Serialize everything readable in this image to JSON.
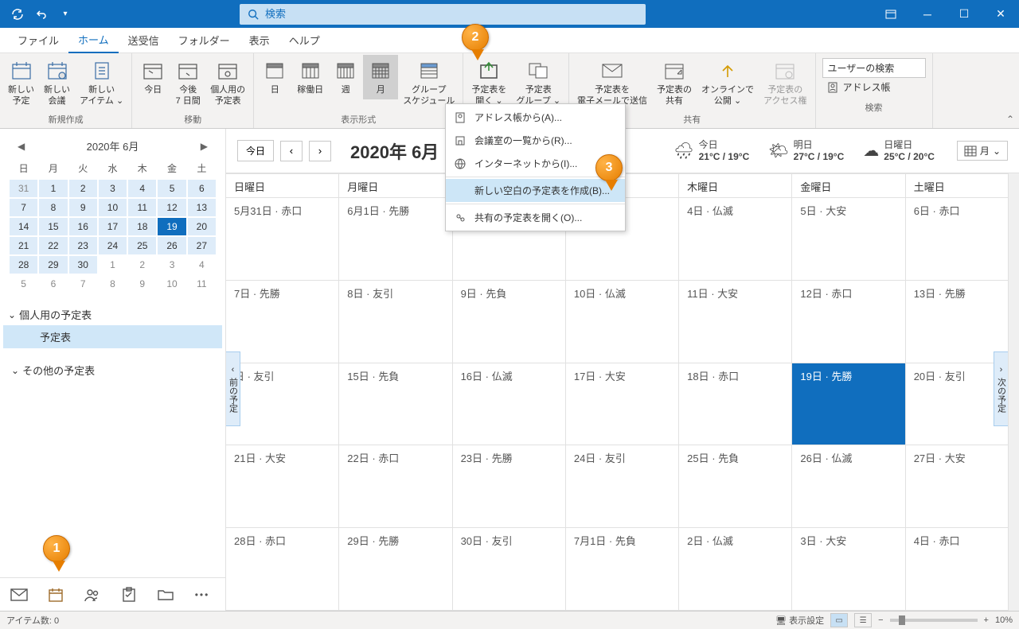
{
  "search_placeholder": "検索",
  "tabs": [
    "ファイル",
    "ホーム",
    "送受信",
    "フォルダー",
    "表示",
    "ヘルプ"
  ],
  "active_tab": 1,
  "ribbon": {
    "new": {
      "label": "新規作成",
      "appointment": "新しい\n予定",
      "meeting": "新しい\n会議",
      "items": "新しい\nアイテム ⌄"
    },
    "move": {
      "label": "移動",
      "today": "今日",
      "next7": "今後\n7 日間",
      "personal": "個人用の\n予定表"
    },
    "arrange": {
      "label": "表示形式",
      "day": "日",
      "workweek": "稼働日",
      "week": "週",
      "month": "月",
      "group": "グループ\nスケジュール"
    },
    "manage": {
      "open_cal": "予定表を\n開く ⌄",
      "cal_groups": "予定表\nグループ ⌄"
    },
    "share": {
      "label": "共有",
      "email": "予定表を\n電子メールで送信",
      "share": "予定表の\n共有",
      "publish": "オンラインで\n公開 ⌄",
      "perms": "予定表の\nアクセス権"
    },
    "find": {
      "label": "検索",
      "search_user": "ユーザーの検索",
      "address_book": "アドレス帳"
    }
  },
  "dropdown": {
    "address": "アドレス帳から(A)...",
    "rooms": "会議室の一覧から(R)...",
    "internet": "インターネットから(I)...",
    "blank": "新しい空白の予定表を作成(B)...",
    "shared": "共有の予定表を開く(O)..."
  },
  "mini_cal": {
    "title": "2020年 6月",
    "dow": [
      "日",
      "月",
      "火",
      "水",
      "木",
      "金",
      "土"
    ],
    "weeks": [
      [
        {
          "d": 31,
          "o": true,
          "c": true
        },
        {
          "d": 1,
          "c": true
        },
        {
          "d": 2,
          "c": true
        },
        {
          "d": 3,
          "c": true
        },
        {
          "d": 4,
          "c": true
        },
        {
          "d": 5,
          "c": true
        },
        {
          "d": 6,
          "c": true
        }
      ],
      [
        {
          "d": 7,
          "c": true
        },
        {
          "d": 8,
          "c": true
        },
        {
          "d": 9,
          "c": true
        },
        {
          "d": 10,
          "c": true
        },
        {
          "d": 11,
          "c": true
        },
        {
          "d": 12,
          "c": true
        },
        {
          "d": 13,
          "c": true
        }
      ],
      [
        {
          "d": 14,
          "c": true
        },
        {
          "d": 15,
          "c": true
        },
        {
          "d": 16,
          "c": true
        },
        {
          "d": 17,
          "c": true
        },
        {
          "d": 18,
          "c": true
        },
        {
          "d": 19,
          "c": true,
          "t": true
        },
        {
          "d": 20,
          "c": true
        }
      ],
      [
        {
          "d": 21,
          "c": true
        },
        {
          "d": 22,
          "c": true
        },
        {
          "d": 23,
          "c": true
        },
        {
          "d": 24,
          "c": true
        },
        {
          "d": 25,
          "c": true
        },
        {
          "d": 26,
          "c": true
        },
        {
          "d": 27,
          "c": true
        }
      ],
      [
        {
          "d": 28,
          "c": true
        },
        {
          "d": 29,
          "c": true
        },
        {
          "d": 30,
          "c": true
        },
        {
          "d": 1,
          "o": true
        },
        {
          "d": 2,
          "o": true
        },
        {
          "d": 3,
          "o": true
        },
        {
          "d": 4,
          "o": true
        }
      ],
      [
        {
          "d": 5,
          "o": true
        },
        {
          "d": 6,
          "o": true
        },
        {
          "d": 7,
          "o": true
        },
        {
          "d": 8,
          "o": true
        },
        {
          "d": 9,
          "o": true
        },
        {
          "d": 10,
          "o": true
        },
        {
          "d": 11,
          "o": true
        }
      ]
    ]
  },
  "cal_list": {
    "personal_header": "個人用の予定表",
    "personal_item": "予定表",
    "other_header": "その他の予定表"
  },
  "cal_toolbar": {
    "today": "今日",
    "title": "2020年 6月",
    "view_label": "月"
  },
  "weather": [
    {
      "label": "今日",
      "temp": "21°C / 19°C",
      "icon": "🌧"
    },
    {
      "label": "明日",
      "temp": "27°C / 19°C",
      "icon": "🌤"
    },
    {
      "label": "日曜日",
      "temp": "25°C / 20°C",
      "icon": "☁"
    }
  ],
  "day_headers": [
    "日曜日",
    "月曜日",
    "",
    "",
    "木曜日",
    "金曜日",
    "土曜日"
  ],
  "side_handles": {
    "prev": "前の予定",
    "next": "次の予定"
  },
  "cells": [
    [
      "5月31日 · 赤口",
      "6月1日 · 先勝",
      "",
      "",
      "4日 · 仏滅",
      "5日 · 大安",
      "6日 · 赤口"
    ],
    [
      "7日 · 先勝",
      "8日 · 友引",
      "9日 · 先負",
      "10日 · 仏滅",
      "11日 · 大安",
      "12日 · 赤口",
      "13日 · 先勝"
    ],
    [
      "日 · 友引",
      "15日 · 先負",
      "16日 · 仏滅",
      "17日 · 大安",
      "18日 · 赤口",
      "19日 · 先勝",
      "20日 · 友引"
    ],
    [
      "21日 · 大安",
      "22日 · 赤口",
      "23日 · 先勝",
      "24日 · 友引",
      "25日 · 先負",
      "26日 · 仏滅",
      "27日 · 大安"
    ],
    [
      "28日 · 赤口",
      "29日 · 先勝",
      "30日 · 友引",
      "7月1日 · 先負",
      "2日 · 仏滅",
      "3日 · 大安",
      "4日 · 赤口"
    ]
  ],
  "today_cell": [
    2,
    5
  ],
  "status": {
    "items": "アイテム数: 0",
    "display": "表示設定",
    "zoom": "10%"
  }
}
